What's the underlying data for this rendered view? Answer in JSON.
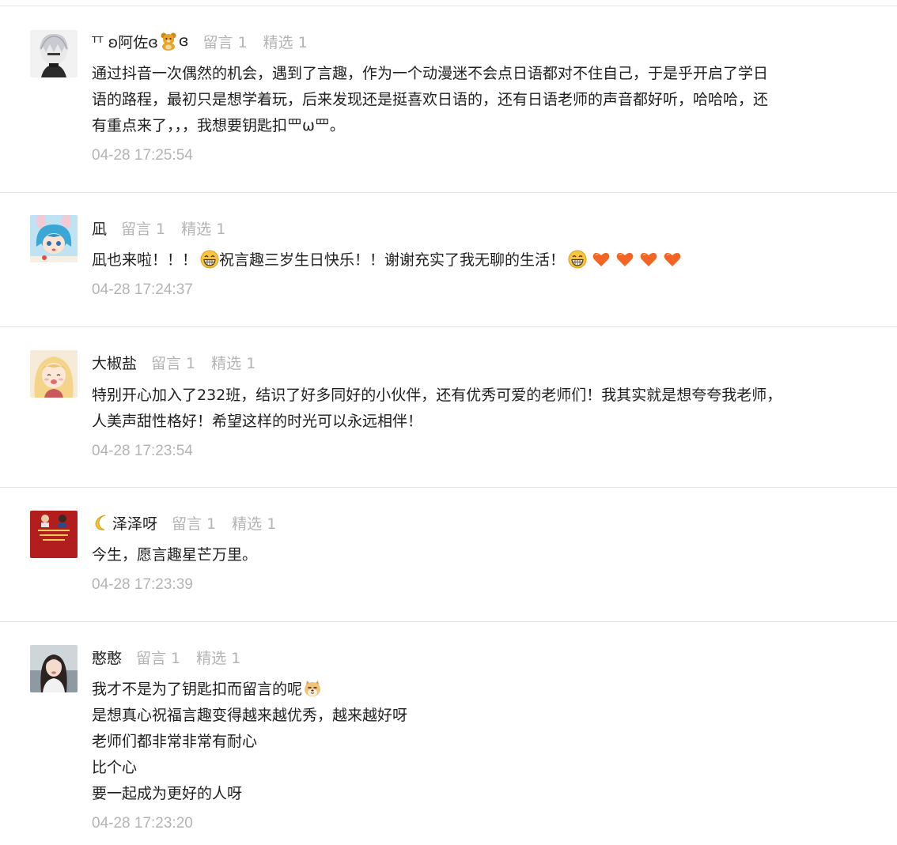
{
  "comments": [
    {
      "nick_prefix": "ᵀᵀ ʚ阿佐ɞ",
      "nick_suffix": "ɞ",
      "replies": "留言 1",
      "featured": "精选 1",
      "lines": [
        "通过抖音一次偶然的机会，遇到了言趣，作为一个动漫迷不会点日语都对不住自己，于是乎开启了学日",
        "语的路程，最初只是想学着玩，后来发现还是挺喜欢日语的，还有日语老师的声音都好听，哈哈哈，还",
        "有重点来了，，，我想要钥匙扣罒ω罒。"
      ],
      "time": "04-28 17:25:54",
      "avatar_icon": "silver-hair-boy-avatar"
    },
    {
      "nick": "凪",
      "replies": "留言 1",
      "featured": "精选 1",
      "line_a": "凪也来啦！！！",
      "line_b": "祝言趣三岁生日快乐！！谢谢充实了我无聊的生活！",
      "time": "04-28 17:24:37",
      "avatar_icon": "blue-hair-anime-girl-avatar"
    },
    {
      "nick": "大椒盐",
      "replies": "留言 1",
      "featured": "精选 1",
      "lines": [
        "特别开心加入了232班，结识了好多同好的小伙伴，还有优秀可爱的老师们！我其实就是想夸夸我老师，",
        "人美声甜性格好！希望这样的时光可以永远相伴！"
      ],
      "time": "04-28 17:23:54",
      "avatar_icon": "blonde-anime-girl-avatar"
    },
    {
      "nick": "泽泽呀",
      "replies": "留言 1",
      "featured": "精选 1",
      "lines": [
        "今生，愿言趣星芒万里。"
      ],
      "time": "04-28 17:23:39",
      "avatar_icon": "red-card-avatar"
    },
    {
      "nick": "憨憨",
      "replies": "留言 1",
      "featured": "精选 1",
      "line_first": "我才不是为了钥匙扣而留言的呢",
      "lines": [
        "是想真心祝福言趣变得越来越优秀，越来越好呀",
        "老师们都非常非常有耐心",
        "比个心",
        "要一起成为更好的人呀"
      ],
      "time": "04-28 17:23:20",
      "avatar_icon": "photo-girl-avatar"
    }
  ],
  "colors": {
    "text": "#1f1f1f",
    "muted": "#b4b4b4",
    "divider": "#e3e3e3",
    "heart": "#f26522",
    "grin_face": "#f7c443"
  }
}
